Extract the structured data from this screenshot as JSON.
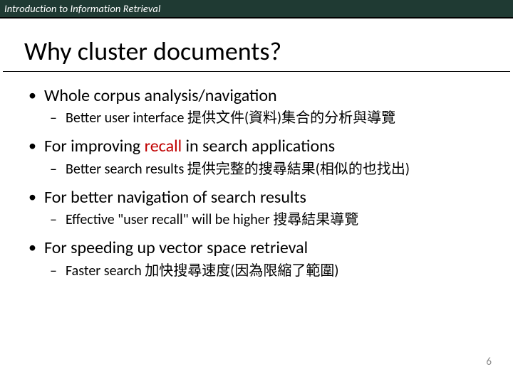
{
  "banner": {
    "course": "Introduction to Information Retrieval"
  },
  "title": "Why cluster documents?",
  "bullets": [
    {
      "text": "Whole corpus analysis/navigation",
      "sub": [
        "Better user interface 提供文件(資料)集合的分析與導覽"
      ]
    },
    {
      "pre": "For improving ",
      "accent": "recall",
      "post": " in search applications",
      "sub": [
        "Better search results 提供完整的搜尋結果(相似的也找出)"
      ]
    },
    {
      "text": "For better navigation of search results",
      "sub": [
        "Effective \"user recall\" will be higher 搜尋結果導覽"
      ]
    },
    {
      "text": "For speeding up vector space retrieval",
      "sub": [
        "Faster search 加快搜尋速度(因為限縮了範圍)"
      ]
    }
  ],
  "page": "6"
}
